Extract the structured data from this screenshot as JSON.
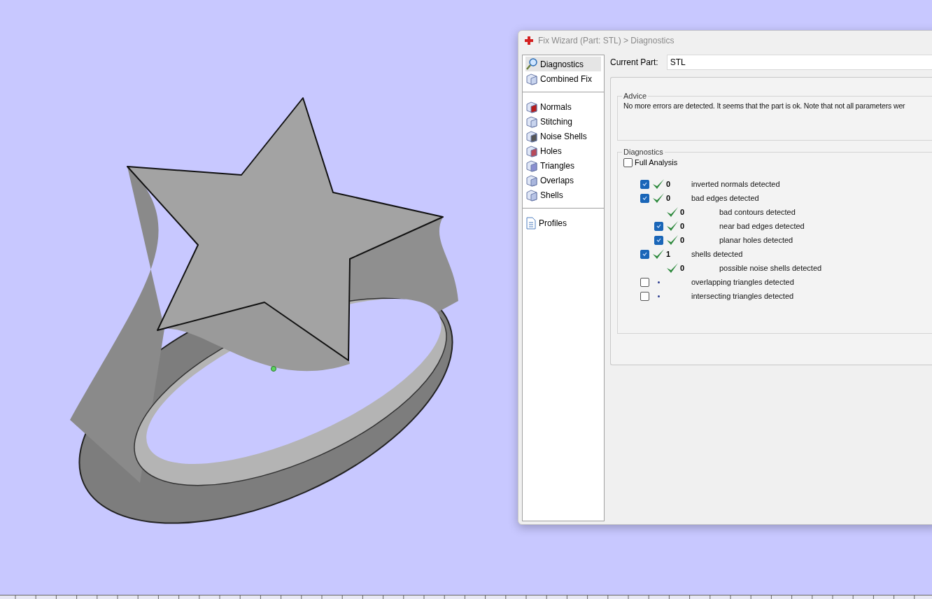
{
  "window": {
    "title": "Fix Wizard (Part: STL) > Diagnostics"
  },
  "sidebar": {
    "groups": [
      [
        {
          "label": "Diagnostics",
          "selected": true
        },
        {
          "label": "Combined Fix",
          "selected": false
        }
      ],
      [
        {
          "label": "Normals",
          "selected": false
        },
        {
          "label": "Stitching",
          "selected": false
        },
        {
          "label": "Noise Shells",
          "selected": false
        },
        {
          "label": "Holes",
          "selected": false
        },
        {
          "label": "Triangles",
          "selected": false
        },
        {
          "label": "Overlaps",
          "selected": false
        },
        {
          "label": "Shells",
          "selected": false
        }
      ],
      [
        {
          "label": "Profiles",
          "selected": false
        }
      ]
    ]
  },
  "current_part": {
    "label": "Current Part:",
    "value": "STL"
  },
  "advice": {
    "title": "Advice",
    "text": "No more errors are detected. It seems that the part is ok. Note that not all parameters wer"
  },
  "diagnostics": {
    "title": "Diagnostics",
    "full_analysis": {
      "label": "Full Analysis",
      "checked": false
    },
    "rows": [
      {
        "kind": "checkbox",
        "checked": true,
        "passed": true,
        "count": "0",
        "label": "inverted normals detected"
      },
      {
        "kind": "checkbox",
        "checked": true,
        "passed": true,
        "count": "0",
        "label": "bad edges detected",
        "children": [
          {
            "kind": "plain",
            "passed": true,
            "count": "0",
            "label": "bad contours detected"
          },
          {
            "kind": "checkbox",
            "checked": true,
            "passed": true,
            "count": "0",
            "label": "near bad edges detected"
          },
          {
            "kind": "checkbox",
            "checked": true,
            "passed": true,
            "count": "0",
            "label": "planar holes detected"
          }
        ]
      },
      {
        "kind": "checkbox",
        "checked": true,
        "passed": true,
        "count": "1",
        "label": "shells detected",
        "children": [
          {
            "kind": "plain",
            "passed": true,
            "count": "0",
            "label": "possible noise shells detected"
          }
        ]
      },
      {
        "kind": "checkbox",
        "checked": false,
        "passed": false,
        "label": "overlapping triangles detected"
      },
      {
        "kind": "checkbox",
        "checked": false,
        "passed": false,
        "label": "intersecting triangles detected"
      }
    ]
  }
}
